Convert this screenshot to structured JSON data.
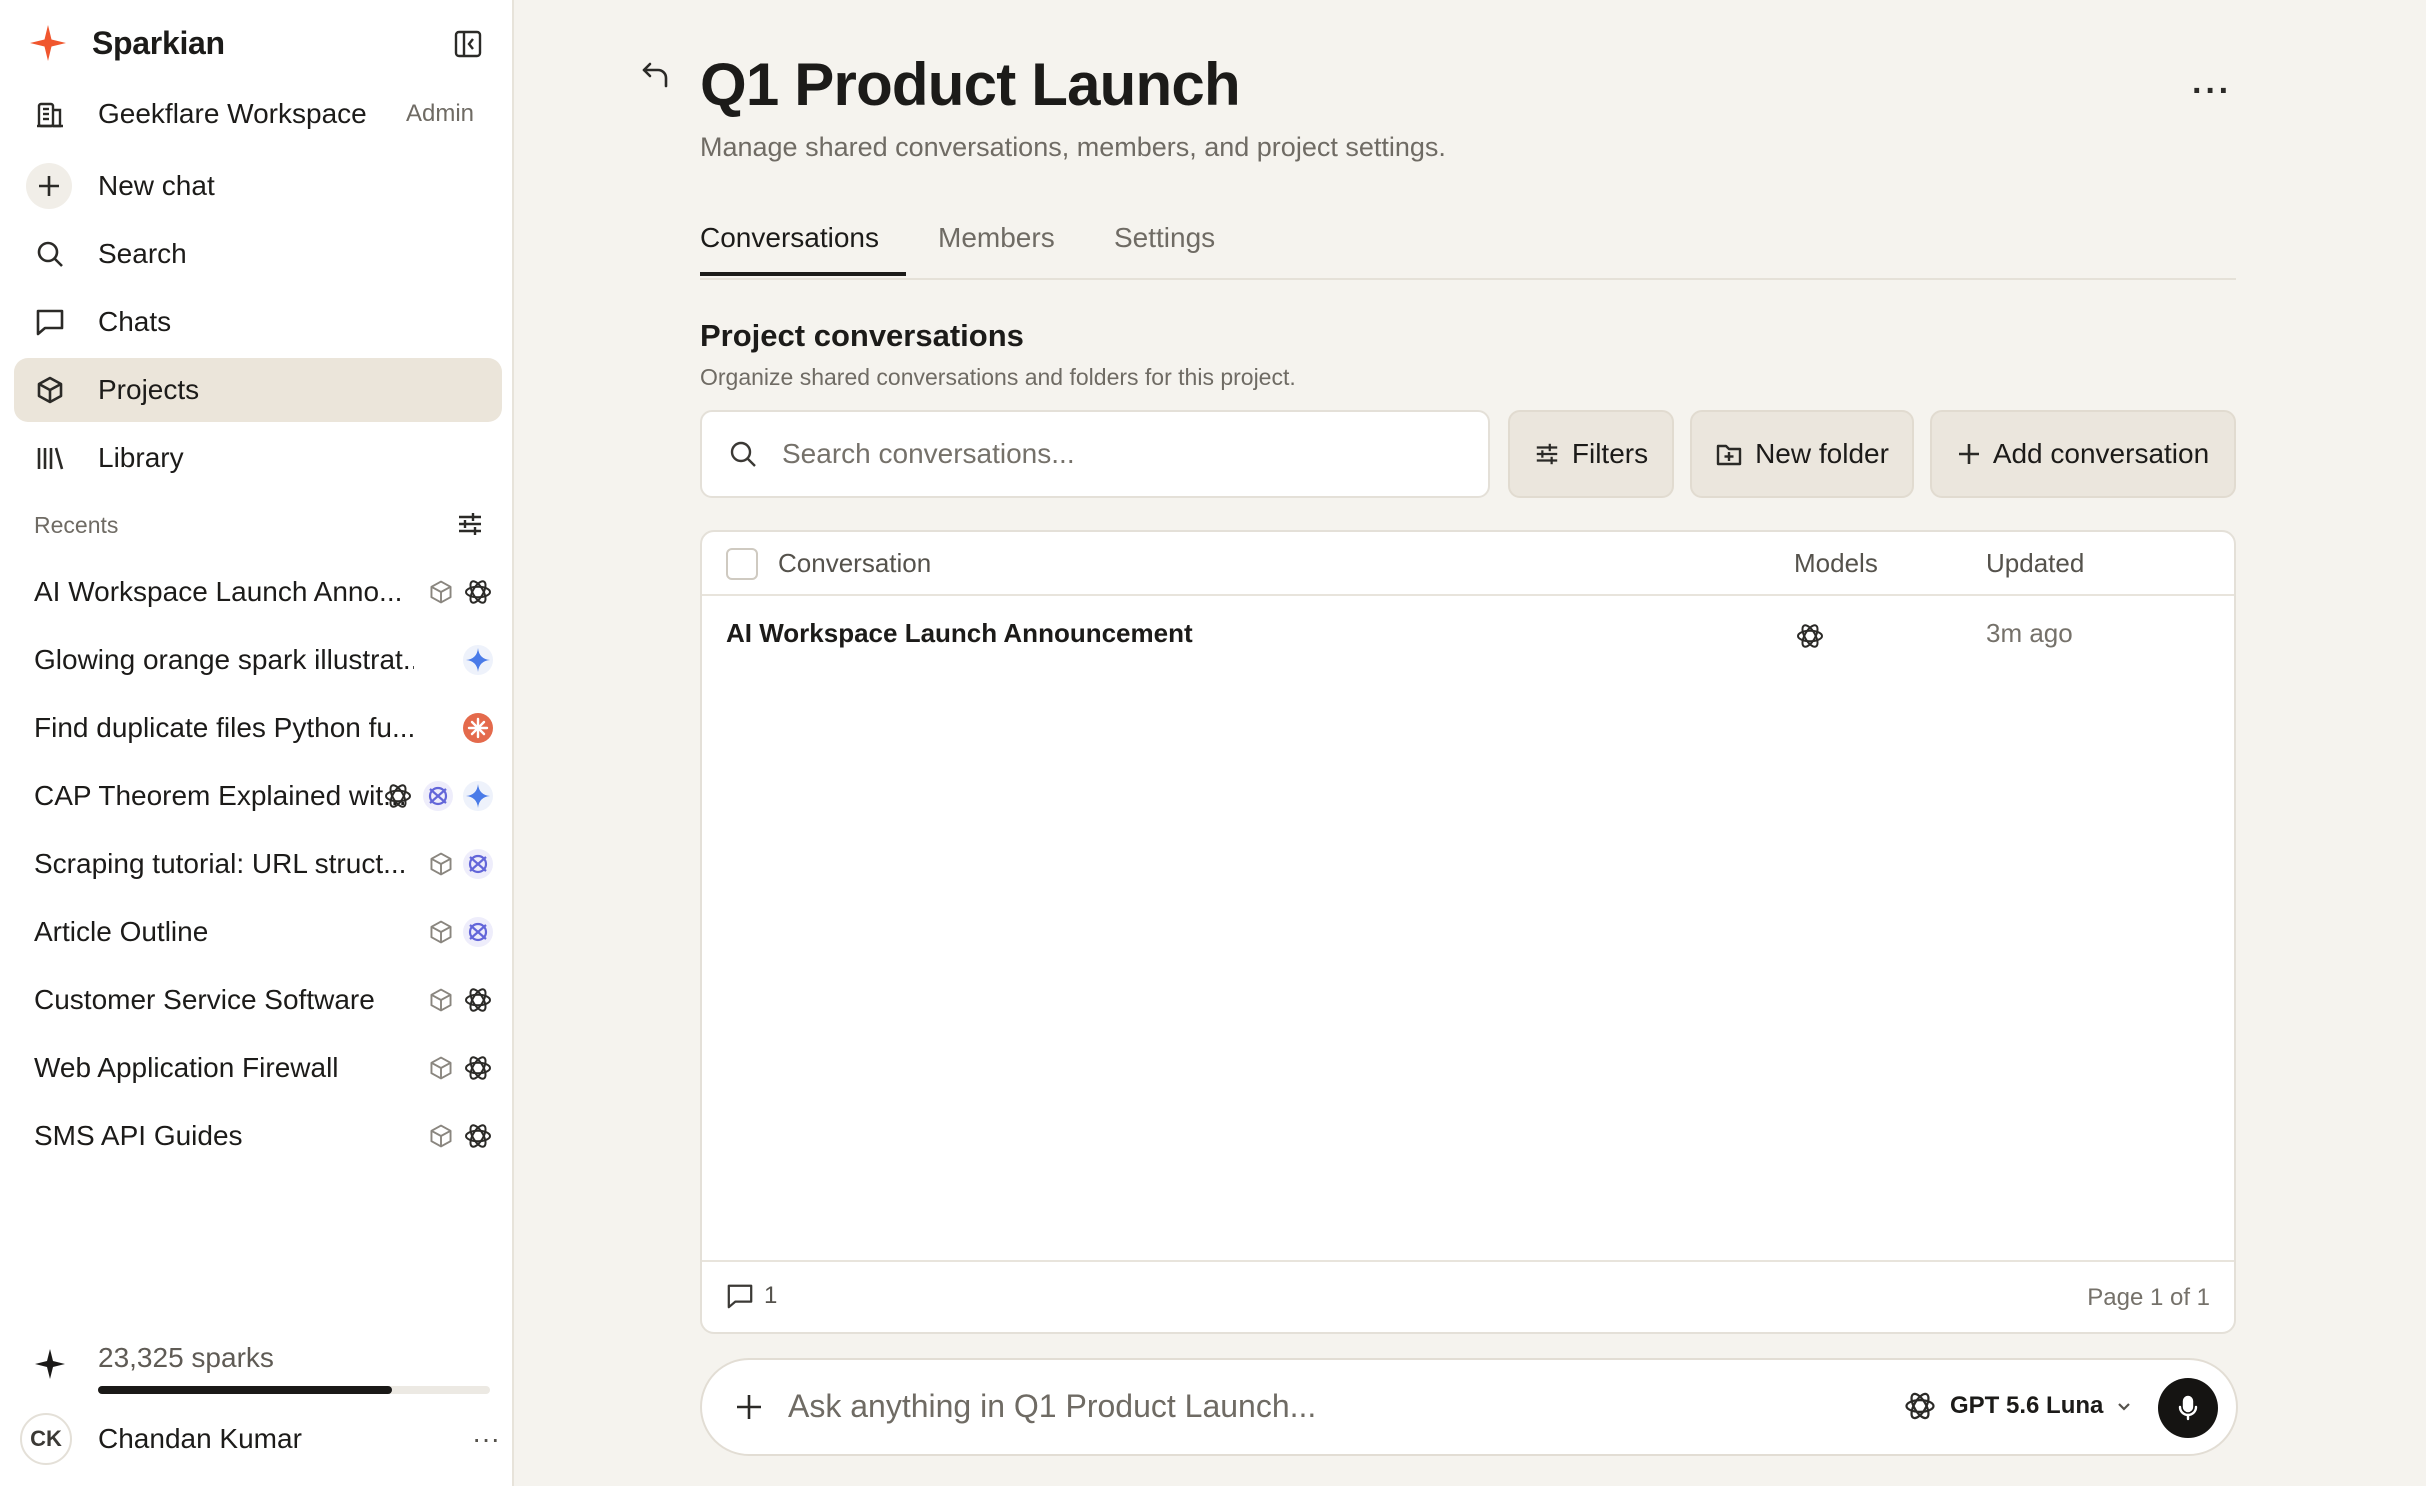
{
  "app": {
    "name": "Sparkian"
  },
  "sidebar": {
    "workspace": {
      "name": "Geekflare Workspace",
      "role": "Admin"
    },
    "nav": [
      {
        "label": "New chat"
      },
      {
        "label": "Search"
      },
      {
        "label": "Chats"
      },
      {
        "label": "Projects"
      },
      {
        "label": "Library"
      }
    ],
    "recents_heading": "Recents",
    "recents": [
      {
        "title": "AI Workspace Launch Anno...",
        "icons": [
          "project-icon",
          "openai-icon"
        ]
      },
      {
        "title": "Glowing orange spark illustrat...",
        "icons": [
          "gemini-icon"
        ]
      },
      {
        "title": "Find duplicate files Python fu...",
        "icons": [
          "claude-icon"
        ]
      },
      {
        "title": "CAP Theorem Explained wit...",
        "icons": [
          "openai-icon",
          "grok-icon",
          "gemini-icon"
        ]
      },
      {
        "title": "Scraping tutorial: URL struct...",
        "icons": [
          "project-icon",
          "grok-icon"
        ]
      },
      {
        "title": "Article Outline",
        "icons": [
          "project-icon",
          "grok-icon"
        ]
      },
      {
        "title": "Customer Service Software",
        "icons": [
          "project-icon",
          "openai-icon"
        ]
      },
      {
        "title": "Web Application Firewall",
        "icons": [
          "project-icon",
          "openai-icon"
        ]
      },
      {
        "title": "SMS API Guides",
        "icons": [
          "project-icon",
          "openai-icon"
        ]
      }
    ],
    "sparks": {
      "label": "23,325 sparks",
      "progress": 0.75
    },
    "user": {
      "initials": "CK",
      "name": "Chandan Kumar",
      "more": "···"
    }
  },
  "main": {
    "title": "Q1 Product Launch",
    "subtitle": "Manage shared conversations, members, and project settings.",
    "more": "···",
    "tabs": [
      {
        "label": "Conversations",
        "active": true
      },
      {
        "label": "Members",
        "active": false
      },
      {
        "label": "Settings",
        "active": false
      }
    ],
    "section": {
      "title": "Project conversations",
      "subtitle": "Organize shared conversations and folders for this project."
    },
    "search": {
      "placeholder": "Search conversations..."
    },
    "buttons": {
      "filters": "Filters",
      "new_folder": "New folder",
      "add_conversation": "Add conversation"
    },
    "table": {
      "headers": {
        "conversation": "Conversation",
        "models": "Models",
        "updated": "Updated"
      },
      "rows": [
        {
          "conversation": "AI Workspace Launch Announcement",
          "model_icon": "openai-icon",
          "updated": "3m ago"
        }
      ],
      "footer": {
        "count": "1",
        "page": "Page 1 of 1"
      }
    },
    "composer": {
      "placeholder": "Ask anything in Q1 Product Launch...",
      "model": "GPT 5.6 Luna"
    }
  },
  "colors": {
    "brand_spark": "#f0562e",
    "active_nav": "#ebe5da",
    "background": "#f5f3ee"
  }
}
